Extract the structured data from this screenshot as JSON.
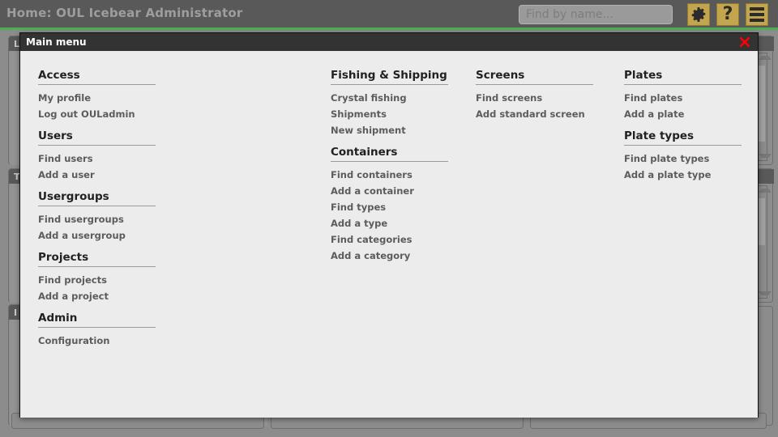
{
  "topbar": {
    "title": "Home: OUL Icebear Administrator",
    "search_placeholder": "Find by name...",
    "search_value": "",
    "gear_icon": "gear-icon",
    "help_icon": "help-icon",
    "help_glyph": "?",
    "menu_icon": "hamburger-icon",
    "accent_color": "#4caf50",
    "icon_button_color": "#c3a54e"
  },
  "dialog": {
    "title": "Main menu",
    "close_label": "✖",
    "close_color": "#ff0000",
    "columns": [
      {
        "groups": [
          {
            "heading": "Access",
            "items": [
              "My profile",
              "Log out OULadmin"
            ]
          },
          {
            "heading": "Users",
            "items": [
              "Find users",
              "Add a user"
            ]
          },
          {
            "heading": "Usergroups",
            "items": [
              "Find usergroups",
              "Add a usergroup"
            ]
          },
          {
            "heading": "Projects",
            "items": [
              "Find projects",
              "Add a project"
            ]
          },
          {
            "heading": "Admin",
            "items": [
              "Configuration"
            ]
          }
        ]
      },
      {
        "groups": [
          {
            "heading": "Fishing & Shipping",
            "items": [
              "Crystal fishing",
              "Shipments",
              "New shipment"
            ]
          },
          {
            "heading": "Containers",
            "items": [
              "Find containers",
              "Add a container",
              "Find types",
              "Add a type",
              "Find categories",
              "Add a category"
            ]
          }
        ]
      },
      {
        "groups": [
          {
            "heading": "Screens",
            "items": [
              "Find screens",
              "Add standard screen"
            ]
          }
        ]
      },
      {
        "groups": [
          {
            "heading": "Plates",
            "items": [
              "Find plates",
              "Add a plate"
            ]
          },
          {
            "heading": "Plate types",
            "items": [
              "Find plate types",
              "Add a plate type"
            ]
          }
        ]
      }
    ]
  },
  "background": {
    "panels": [
      {
        "label": "L"
      },
      {
        "label": "T"
      },
      {
        "label": "I"
      }
    ]
  }
}
